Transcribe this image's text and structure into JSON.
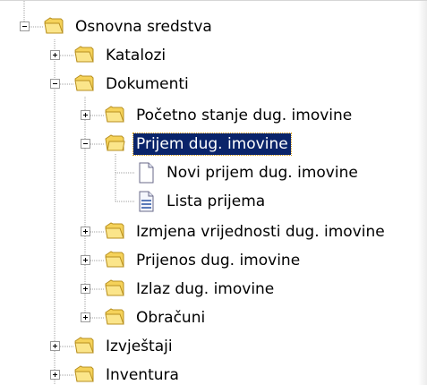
{
  "tree": {
    "nodes": [
      {
        "label": "Osnovna sredstva",
        "state": "expanded",
        "icon": "folder-icon"
      },
      {
        "label": "Katalozi",
        "state": "collapsed",
        "icon": "folder-icon"
      },
      {
        "label": "Dokumenti",
        "state": "expanded",
        "icon": "folder-icon"
      },
      {
        "label": "Početno stanje dug. imovine",
        "state": "collapsed",
        "icon": "folder-icon"
      },
      {
        "label": "Prijem dug. imovine",
        "state": "expanded",
        "icon": "folder-open-icon",
        "selected": true
      },
      {
        "label": "Novi prijem dug. imovine",
        "state": "leaf",
        "icon": "document-icon"
      },
      {
        "label": "Lista prijema",
        "state": "leaf",
        "icon": "list-document-icon"
      },
      {
        "label": "Izmjena vrijednosti dug. imovine",
        "state": "collapsed",
        "icon": "folder-icon"
      },
      {
        "label": "Prijenos dug. imovine",
        "state": "collapsed",
        "icon": "folder-icon"
      },
      {
        "label": "Izlaz dug. imovine",
        "state": "collapsed",
        "icon": "folder-icon"
      },
      {
        "label": "Obračuni",
        "state": "collapsed",
        "icon": "folder-icon"
      },
      {
        "label": "Izvještaji",
        "state": "collapsed",
        "icon": "folder-icon"
      },
      {
        "label": "Inventura",
        "state": "collapsed",
        "icon": "folder-icon"
      }
    ]
  },
  "colors": {
    "selection": "#0a246a",
    "folder": "#f5d25a",
    "tree_lines": "#a0a0a0"
  }
}
